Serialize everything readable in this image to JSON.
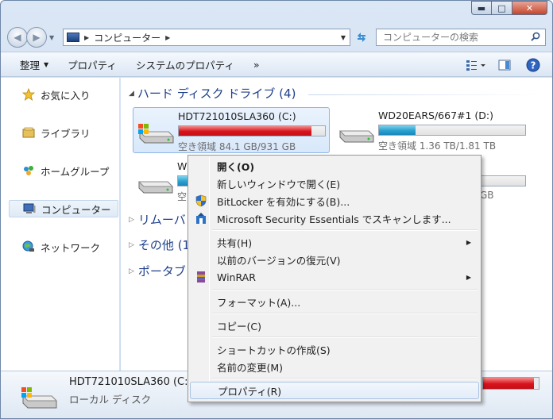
{
  "window": {
    "controls": {
      "minimize": "▬",
      "maximize": "□",
      "close": "✕"
    }
  },
  "address": {
    "path": "コンピューター",
    "search_placeholder": "コンピューターの検索"
  },
  "toolbar": {
    "items": [
      {
        "label": "整理",
        "has_dropdown": true
      },
      {
        "label": "プロパティ"
      },
      {
        "label": "システムのプロパティ"
      },
      {
        "label": "»"
      }
    ]
  },
  "sidebar": {
    "items": [
      {
        "label": "お気に入り",
        "icon": "star-icon"
      },
      {
        "label": "ライブラリ",
        "icon": "library-icon"
      },
      {
        "label": "ホームグループ",
        "icon": "homegroup-icon"
      },
      {
        "label": "コンピューター",
        "icon": "computer-icon",
        "selected": true
      },
      {
        "label": "ネットワーク",
        "icon": "network-icon"
      }
    ]
  },
  "content": {
    "hdd_header": "ハード ディスク ドライブ (4)",
    "drives": [
      {
        "name": "HDT721010SLA360 (C:)",
        "free": "空き領域 84.1 GB/931 GB",
        "used_fraction": 0.91,
        "bar_color": "red",
        "selected": true
      },
      {
        "name": "WD20EARS/667#1 (D:)",
        "free": "空き領域 1.36 TB/1.81 TB",
        "used_fraction": 0.25,
        "bar_color": "blue"
      },
      {
        "name": "W",
        "free": "空",
        "used_fraction": 0.5,
        "bar_color": "blue"
      },
      {
        "name": "",
        "free": "GB",
        "used_fraction": 0.0,
        "bar_color": "blue"
      }
    ],
    "sections": [
      {
        "label": "リムーバ"
      },
      {
        "label": "その他 (1"
      },
      {
        "label": "ポータブ"
      }
    ]
  },
  "context_menu": {
    "items": [
      {
        "label": "開く(O)",
        "bold": true
      },
      {
        "label": "新しいウィンドウで開く(E)"
      },
      {
        "label": "BitLocker を有効にする(B)...",
        "icon": "shield-icon"
      },
      {
        "label": "Microsoft Security Essentials でスキャンします...",
        "icon": "security-essentials-icon"
      },
      {
        "label": "共有(H)",
        "submenu": true
      },
      {
        "label": "以前のバージョンの復元(V)"
      },
      {
        "label": "WinRAR",
        "icon": "winrar-icon",
        "submenu": true
      },
      {
        "label": "フォーマット(A)..."
      },
      {
        "label": "コピー(C)"
      },
      {
        "label": "ショートカットの作成(S)"
      },
      {
        "label": "名前の変更(M)"
      },
      {
        "label": "プロパティ(R)",
        "hover": true
      }
    ]
  },
  "details": {
    "name": "HDT721010SLA360 (C:",
    "type": "ローカル ディスク",
    "used_fraction": 0.91
  }
}
